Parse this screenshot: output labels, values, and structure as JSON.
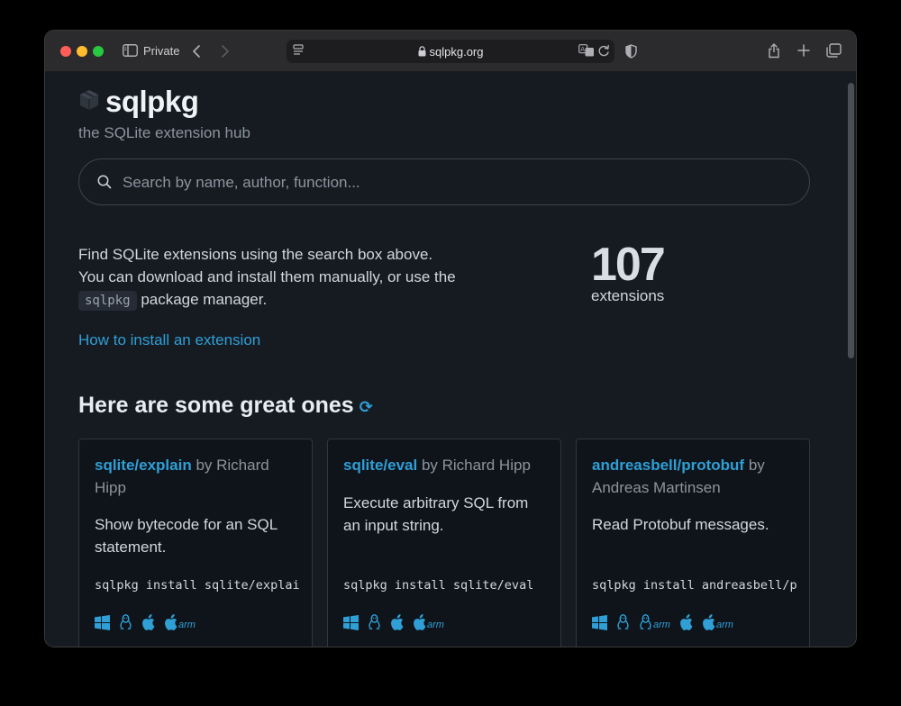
{
  "browser": {
    "private_label": "Private",
    "url": "sqlpkg.org"
  },
  "brand": {
    "title": "sqlpkg",
    "tagline": "the SQLite extension hub"
  },
  "search": {
    "placeholder": "Search by name, author, function..."
  },
  "intro": {
    "line1": "Find SQLite extensions using the search box above. You can download and install them manually, or use the",
    "code": "sqlpkg",
    "line2": "package manager.",
    "link": "How to install an extension"
  },
  "stats": {
    "count": "107",
    "label": "extensions"
  },
  "section": {
    "title": "Here are some great ones",
    "refresh_icon": "refresh-icon"
  },
  "cards": [
    {
      "name": "sqlite/explain",
      "by": "by Richard Hipp",
      "description": "Show bytecode for an SQL statement.",
      "command": "sqlpkg install sqlite/explai",
      "platforms": [
        "windows",
        "linux",
        "macos",
        "macos-arm"
      ]
    },
    {
      "name": "sqlite/eval",
      "by": "by Richard Hipp",
      "description": "Execute arbitrary SQL from an input string.",
      "command": "sqlpkg install sqlite/eval",
      "platforms": [
        "windows",
        "linux",
        "macos",
        "macos-arm"
      ]
    },
    {
      "name": "andreasbell/protobuf",
      "by": "by Andreas Martinsen",
      "description": "Read Protobuf messages.",
      "command": "sqlpkg install andreasbell/p",
      "platforms": [
        "windows",
        "linux",
        "linux-arm",
        "macos",
        "macos-arm"
      ]
    }
  ],
  "arm_label": "arm"
}
